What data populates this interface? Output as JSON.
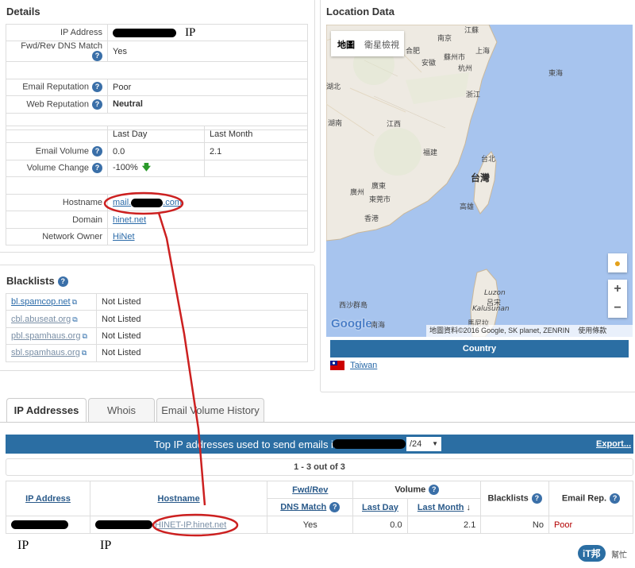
{
  "details": {
    "title": "Details",
    "ip_label": "IP Address",
    "ip_annot": "IP",
    "dns_label": "Fwd/Rev DNS Match",
    "dns_value": "Yes",
    "email_rep_label": "Email Reputation",
    "email_rep_value": "Poor",
    "web_rep_label": "Web Reputation",
    "web_rep_value": "Neutral",
    "col_last_day": "Last Day",
    "col_last_month": "Last Month",
    "volume_label": "Email Volume",
    "volume_day": "0.0",
    "volume_month": "2.1",
    "change_label": "Volume Change",
    "change_day": "-100%",
    "hostname_label": "Hostname",
    "hostname_prefix": "mail.",
    "hostname_suffix": ".com",
    "domain_label": "Domain",
    "domain_value": "hinet.net",
    "owner_label": "Network Owner",
    "owner_value": "HiNet"
  },
  "blacklists": {
    "title": "Blacklists",
    "rows": [
      {
        "name": "bl.spamcop.net",
        "status": "Not Listed"
      },
      {
        "name": "cbl.abuseat.org",
        "status": "Not Listed"
      },
      {
        "name": "pbl.spamhaus.org",
        "status": "Not Listed"
      },
      {
        "name": "sbl.spamhaus.org",
        "status": "Not Listed"
      }
    ]
  },
  "location": {
    "title": "Location Data",
    "map_btn": "地圖",
    "sat_btn": "衛星檢視",
    "attribution": "地圖資料©2016 Google, SK planet, ZENRIN",
    "terms": "使用條款",
    "google": "Google",
    "country_header": "Country",
    "country_value": "Taiwan",
    "labels": {
      "jiangsu": "江蘇",
      "nanjing": "南京",
      "hefei": "合肥",
      "suzhou": "蘇州市",
      "shanghai": "上海",
      "anhui": "安徽",
      "hangzhou": "杭州",
      "zhejiang": "浙江",
      "hubei": "湖北",
      "hunan": "湖南",
      "jiangxi": "江西",
      "fujian": "福建",
      "taipei": "台北",
      "taiwan": "台灣",
      "kaohsiung": "高雄",
      "guangdong": "廣東",
      "guangzhou": "廣州",
      "dongguan": "東莞市",
      "hongkong": "香港",
      "donghai": "東海",
      "xisha": "西沙群島",
      "luzon": "呂宋",
      "luzon_en": "Luzon",
      "kalusunan": "Kalusunan",
      "manila": "馬尼拉",
      "nanhai": "南海"
    }
  },
  "tabs": [
    "IP Addresses",
    "Whois",
    "Email Volume History"
  ],
  "results": {
    "bar_prefix": "Top IP addresses used to send emails in",
    "cidr": "/24",
    "export": "Export...",
    "paging": "1 - 3 out of 3",
    "headers": {
      "ip": "IP Address",
      "hostname": "Hostname",
      "fwd": "Fwd/Rev",
      "dns": "DNS Match",
      "volume": "Volume",
      "last_day": "Last Day",
      "last_month": "Last Month",
      "sort_arrow": "↓",
      "blacklists": "Blacklists",
      "email_rep": "Email Rep."
    },
    "row": {
      "hostname": "HINET-IP.hinet.net",
      "dns": "Yes",
      "last_day": "0.0",
      "last_month": "2.1",
      "blacklists": "No",
      "email_rep": "Poor"
    }
  },
  "annotations": {
    "ip_left": "IP",
    "ip_right": "IP"
  },
  "watermark": {
    "logo": "iT邦",
    "sub": "幫忙"
  }
}
